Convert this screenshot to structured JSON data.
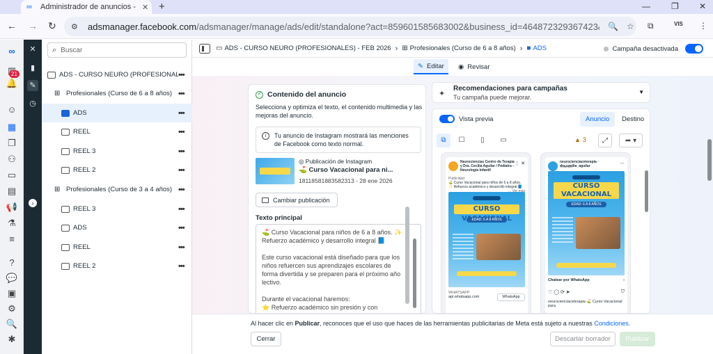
{
  "browser": {
    "tab_title": "Administrador de anuncios - A",
    "tab_close": "✕",
    "new_tab": "+",
    "url_host": "adsmanager.facebook.com",
    "url_rest": "/adsmanager/manage/ads/edit/standalone?act=859601585683002&business_id=464872329367423&global_scope_id...",
    "profile_label": "VIS"
  },
  "rail": {
    "notif_count": "21"
  },
  "tree": {
    "search_placeholder": "Buscar",
    "items": [
      {
        "label": "ADS - CURSO NEURO (PROFESIONAL...",
        "icon": "folder"
      },
      {
        "label": "Profesionales (Curso de 6 a 8 años)",
        "icon": "grid"
      },
      {
        "label": "ADS",
        "icon": "ad-blue"
      },
      {
        "label": "REEL",
        "icon": "ad"
      },
      {
        "label": "REEL 3",
        "icon": "ad"
      },
      {
        "label": "REEL 2",
        "icon": "ad"
      },
      {
        "label": "Profesionales (Curso de 3 a 4 años)",
        "icon": "grid"
      },
      {
        "label": "REEL 3",
        "icon": "ad"
      },
      {
        "label": "ADS",
        "icon": "ad"
      },
      {
        "label": "REEL",
        "icon": "ad"
      },
      {
        "label": "REEL 2",
        "icon": "ad"
      }
    ],
    "dots": "•••"
  },
  "breadcrumb": {
    "campaign": "ADS - CURSO NEURO (PROFESIONALES) - FEB 2026",
    "adset": "Profesionales (Curso de 6 a 8 años)",
    "ad": "ADS",
    "status": "Campaña desactivada"
  },
  "modes": {
    "edit": "Editar",
    "review": "Revisar"
  },
  "editor": {
    "title": "Contenido del anuncio",
    "description": "Selecciona y optimiza el texto, el contenido multimedia y las mejoras del anuncio.",
    "info": "Tu anuncio de Instagram mostrará las menciones de Facebook como texto normal.",
    "post_type": "Publicación de Instagram",
    "post_title": "⛳ Curso Vacacional para ni...",
    "post_meta": "18118581883582313 - 28 ene 2026",
    "change_button": "Cambiar publicación",
    "main_text_label": "Texto principal",
    "main_text": [
      "⛳ Curso Vacacional para niños de 6 a 8 años. ✨ Refuerzo académico y desarrollo integral 📘",
      "Este curso vacacional está diseñado para que los niños refuercen sus aprendizajes escolares de forma divertida y se preparen para el próximo año lectivo.",
      "Durante el vacacional haremos:\n⭐ Refuerzo académico sin presión y con metodología lúdica"
    ]
  },
  "recommendations": {
    "title": "Recomendaciones para campañas",
    "subtitle": "Tu campaña puede mejorar."
  },
  "preview": {
    "toggle_label": "Vista previa",
    "tab_ad": "Anuncio",
    "tab_destination": "Destino",
    "warning_count": "3",
    "phone1": {
      "account": "Neurociencias Centro de Terapia y Dra. Cecilia Aguilar / Pediatra - Neurología Infantil",
      "sponsored": "Publicidad",
      "caption": "⛳ Curso Vacacional para niños de 6 a 8 años. ✨ Refuerzo académico y desarrollo integral 📘",
      "more": "... Ver más",
      "poster_title": "CURSO VACACIONAL",
      "poster_age": "EDAD: 6 A 8 AÑOS",
      "footer_label": "WHATSAPP",
      "footer_domain": "api.whatsapp.com",
      "wa_button": "WhatsApp"
    },
    "phone2": {
      "account": "neurocienciaceterapia · dra.cecilia_aguilar",
      "sponsored": "Anuncio",
      "poster_title": "CURSO VACACIONAL",
      "poster_age": "EDAD: 6 A 8 AÑOS",
      "cta": "Chatear por WhatsApp",
      "caption": "neurocienciaceterapia ⛳ Curso Vacacional para"
    }
  },
  "footer": {
    "text_pre": "Al hacer clic en ",
    "text_bold": "Publicar",
    "text_post": ", reconoces que el uso que haces de las herramientas publicitarias de Meta está sujeto a nuestras ",
    "link": "Condiciones",
    "text_end": ".",
    "close": "Cerrar",
    "discard": "Descartar borrador",
    "publish": "Publicar"
  }
}
